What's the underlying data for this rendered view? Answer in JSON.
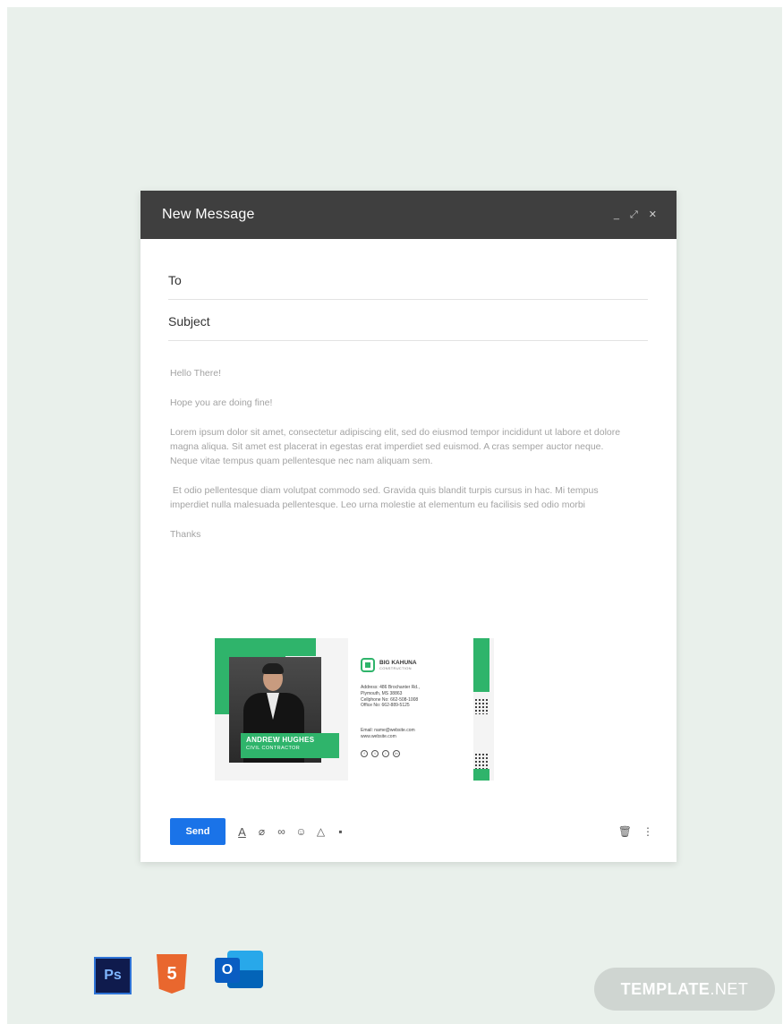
{
  "window": {
    "title": "New Message",
    "controls": {
      "minimize": "_",
      "expand": "⤢",
      "close": "✕"
    }
  },
  "fields": {
    "to_label": "To",
    "to_value": "",
    "subject_label": "Subject",
    "subject_value": ""
  },
  "body": {
    "greeting": "Hello There!",
    "line1": "Hope you are doing fine!",
    "para1": "Lorem ipsum dolor sit amet, consectetur adipiscing elit, sed do eiusmod tempor incididunt ut labore et dolore magna aliqua. Sit amet est placerat in egestas erat imperdiet sed euismod. A cras semper auctor neque. Neque vitae tempus quam pellentesque nec nam aliquam sem.",
    "para2": " Et odio pellentesque diam volutpat commodo sed. Gravida quis blandit turpis cursus in hac. Mi tempus imperdiet nulla malesuada pellentesque. Leo urna molestie at elementum eu facilisis sed odio morbi",
    "closing": "Thanks"
  },
  "signature": {
    "name": "ANDREW HUGHES",
    "role": "CIVIL CONTRACTOR",
    "company": "BIG KAHUNA",
    "company_sub": "CONSTRUCTION",
    "address1": "Address: 486 Brochanter Rd.,",
    "address2": "Plymouth, MS 38863",
    "cellphone": "Cellphone No: 662-508-1008",
    "office": "Office No: 662-889-5125",
    "email": "Email: name@website.com",
    "website": "www.website.com",
    "socials": [
      "f",
      "t",
      "i",
      "in"
    ],
    "accent_color": "#2fb46b"
  },
  "toolbar": {
    "send_label": "Send",
    "icons": [
      "format-text-icon",
      "attach-icon",
      "link-icon",
      "emoji-icon",
      "drive-icon",
      "photo-icon"
    ],
    "format_glyph": "A",
    "attach_glyph": "⌀",
    "link_glyph": "∞",
    "emoji_glyph": "☺",
    "drive_glyph": "△",
    "photo_glyph": "▪",
    "trash_glyph": "🗑",
    "more_glyph": "⋮"
  },
  "badges": {
    "ps": "Ps",
    "html": "5",
    "outlook": "O",
    "brand_bold": "TEMPLATE",
    "brand_light": ".NET"
  }
}
